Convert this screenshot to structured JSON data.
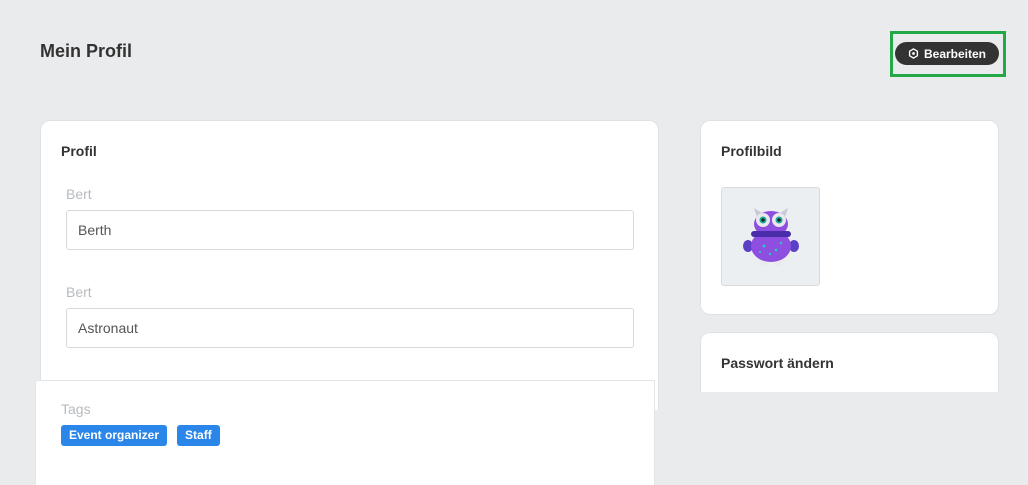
{
  "header": {
    "title": "Mein Profil",
    "edit_label": "Bearbeiten",
    "edit_icon": "gear-icon",
    "highlight_color": "#22a844"
  },
  "profile_card": {
    "title": "Profil",
    "fields": [
      {
        "label": "Bert",
        "value": "Berth"
      },
      {
        "label": "Bert",
        "value": "Astronaut"
      }
    ]
  },
  "tags_card": {
    "label": "Tags",
    "tags": [
      "Event organizer",
      "Staff"
    ],
    "tag_color": "#2a86e8"
  },
  "picture_card": {
    "title": "Profilbild",
    "avatar_icon": "purple-monster-avatar"
  },
  "password_card": {
    "title": "Passwort ändern"
  }
}
